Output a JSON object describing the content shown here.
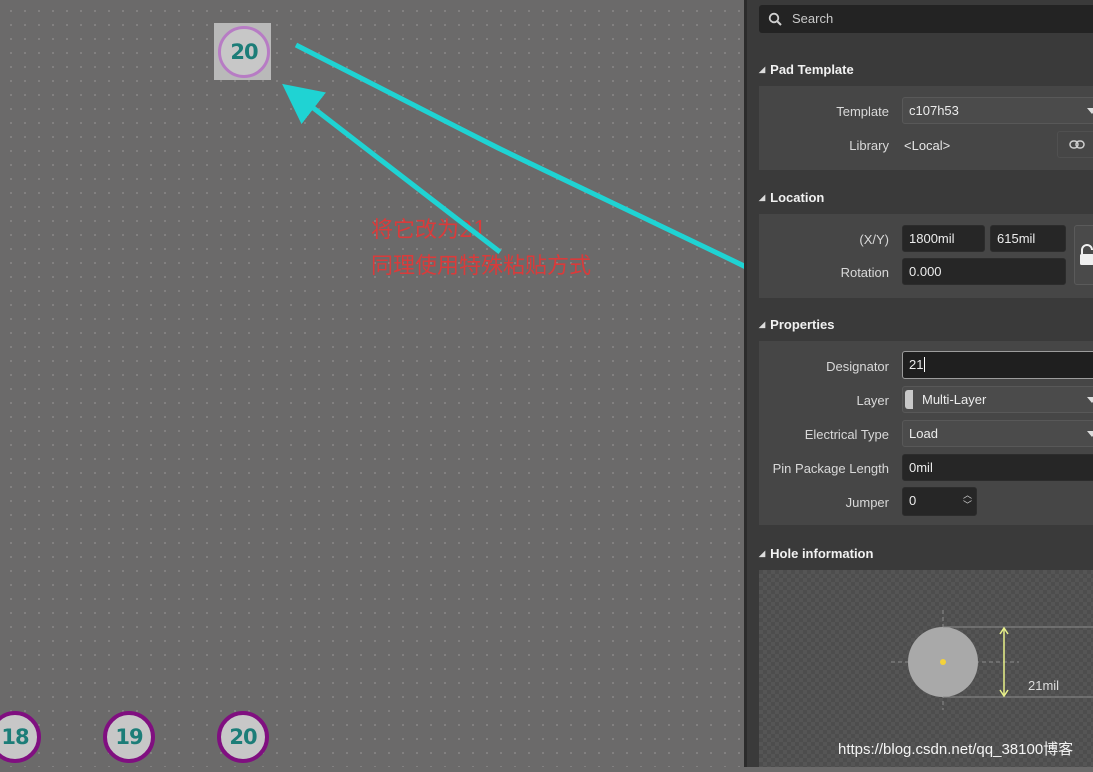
{
  "canvas": {
    "pad_top": "20",
    "pads_bottom": [
      "18",
      "19",
      "20"
    ],
    "annotation": {
      "line1": "将它改为21",
      "line2": "同理使用特殊粘贴方式"
    }
  },
  "search": {
    "placeholder": "Search"
  },
  "pad_template": {
    "header": "Pad Template",
    "template_label": "Template",
    "template_value": "c107h53",
    "library_label": "Library",
    "library_value": "<Local>"
  },
  "location": {
    "header": "Location",
    "xy_label": "(X/Y)",
    "x_value": "1800mil",
    "y_value": "615mil",
    "rotation_label": "Rotation",
    "rotation_value": "0.000"
  },
  "properties": {
    "header": "Properties",
    "designator_label": "Designator",
    "designator_value": "21",
    "layer_label": "Layer",
    "layer_value": "Multi-Layer",
    "electrical_label": "Electrical Type",
    "electrical_value": "Load",
    "pin_pkg_label": "Pin Package Length",
    "pin_pkg_value": "0mil",
    "jumper_label": "Jumper",
    "jumper_value": "0"
  },
  "hole": {
    "header": "Hole information",
    "dimension": "21mil"
  },
  "watermark": "https://blog.csdn.net/qq_38100博客",
  "colors": {
    "canvas_bg": "#6b6a6a",
    "panel_bg": "#3a3a3a",
    "pad_ring": "#800f80",
    "pad_text": "#1c7d78",
    "arrow": "#1fd3d3",
    "annotation_text": "#d93b3b"
  }
}
